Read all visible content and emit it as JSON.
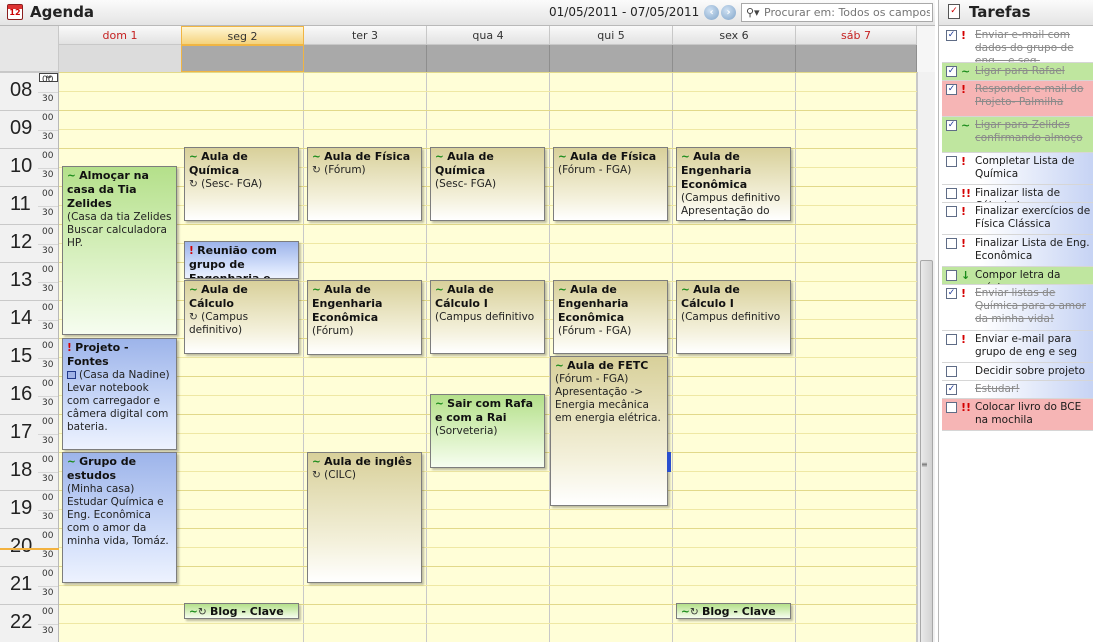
{
  "agenda": {
    "title": "Agenda",
    "icon": "calendar-icon",
    "date_range": "01/05/2011 - 07/05/2011",
    "search_placeholder": "Procurar em: Todos os campos",
    "days": [
      "dom 1",
      "seg 2",
      "ter 3",
      "qua 4",
      "qui 5",
      "sex 6",
      "sáb 7"
    ],
    "hours": [
      "08",
      "09",
      "10",
      "11",
      "12",
      "13",
      "14",
      "15",
      "16",
      "17",
      "18",
      "19",
      "20",
      "21",
      "22"
    ],
    "minute_labels": [
      "00",
      "30"
    ],
    "colors": {
      "weekday_bg": "#fffed7",
      "weekend_header": "#c52020",
      "today_border": "#f0b543"
    }
  },
  "events": {
    "dom_almocar": {
      "title": "Almoçar na casa da Tia Zelides",
      "lines": [
        "(Casa da tia Zelides",
        "Buscar calculadora HP."
      ]
    },
    "dom_projeto": {
      "title": "Projeto - Fontes",
      "lines": [
        "(Casa da Nadine)",
        "Levar notebook com carregador e câmera digital com bateria."
      ]
    },
    "dom_grupo": {
      "title": "Grupo de estudos",
      "lines": [
        "(Minha casa)",
        "Estudar Química e Eng. Econômica com o amor da minha vida, Tomáz."
      ]
    },
    "seg_quimica": {
      "title": "Aula de Química",
      "lines": [
        "(Sesc- FGA)"
      ]
    },
    "seg_reuniao": {
      "title": "Reunião com grupo de Engenharia e",
      "lines": []
    },
    "seg_calculo": {
      "title": "Aula de Cálculo",
      "lines": [
        "(Campus definitivo)"
      ]
    },
    "seg_blog": {
      "title": "Blog - Clave",
      "lines": []
    },
    "ter_fisica": {
      "title": "Aula de Física",
      "lines": [
        "(Fórum)"
      ]
    },
    "ter_engecon": {
      "title": "Aula de Engenharia Econômica",
      "lines": [
        "(Fórum)"
      ]
    },
    "ter_ingles": {
      "title": "Aula de inglês",
      "lines": [
        "(CILC)"
      ]
    },
    "qua_quimica": {
      "title": "Aula de Química",
      "lines": [
        "(Sesc- FGA)"
      ]
    },
    "qua_calculo": {
      "title": "Aula de Cálculo I",
      "lines": [
        "(Campus definitivo"
      ]
    },
    "qua_sair": {
      "title": "Sair com Rafa e com a Rai",
      "lines": [
        "(Sorveteria)"
      ]
    },
    "qui_fisica": {
      "title": "Aula de Física",
      "lines": [
        "(Fórum - FGA)"
      ]
    },
    "qui_engecon": {
      "title": "Aula de Engenharia Econômica",
      "lines": [
        "(Fórum - FGA)"
      ]
    },
    "qui_fetc": {
      "title": "Aula de FETC",
      "lines": [
        "(Fórum - FGA)",
        "Apresentação -> Energia mecânica em energia elétrica."
      ]
    },
    "sex_engecon": {
      "title": "Aula de Engenharia Econômica",
      "lines": [
        "(Campus definitivo",
        "Apresentação do seminário. Tema:"
      ]
    },
    "sex_calculo": {
      "title": "Aula de Cálculo I",
      "lines": [
        "(Campus definitivo"
      ]
    },
    "sex_blog": {
      "title": "Blog - Clave",
      "lines": []
    }
  },
  "tasks": {
    "title": "Tarefas",
    "items": [
      {
        "label": "Enviar e-mail com dados do grupo de eng... e seg.",
        "checked": true,
        "priority": "!",
        "color": "plain",
        "done": true
      },
      {
        "label": "Ligar para Rafael",
        "checked": true,
        "priority": "~",
        "color": "green",
        "done": true
      },
      {
        "label": "Responder e-mail do Projeto- Palmilha",
        "checked": true,
        "priority": "!",
        "color": "red",
        "done": true
      },
      {
        "label": "Ligar para Zelides confirmando almoço",
        "checked": true,
        "priority": "~",
        "color": "green",
        "done": true
      },
      {
        "label": "Completar Lista de Química",
        "checked": false,
        "priority": "!",
        "color": "blue",
        "done": false
      },
      {
        "label": "Finalizar lista de Cálculo I",
        "checked": false,
        "priority": "!!",
        "color": "blue",
        "done": false
      },
      {
        "label": "Finalizar exercícios de Física Clássica",
        "checked": false,
        "priority": "!",
        "color": "blue",
        "done": false
      },
      {
        "label": "Finalizar Lista de Eng. Econômica",
        "checked": false,
        "priority": "!",
        "color": "blue",
        "done": false
      },
      {
        "label": "Compor letra da música",
        "checked": false,
        "priority": "↓",
        "color": "green",
        "done": false
      },
      {
        "label": "Enviar listas de Química para o amor da minha vida!",
        "checked": true,
        "priority": "!",
        "color": "blue",
        "done": true
      },
      {
        "label": "Enviar e-mail para grupo de eng e seg",
        "checked": false,
        "priority": "!",
        "color": "blue",
        "done": false
      },
      {
        "label": "Decidir sobre projeto",
        "checked": false,
        "priority": "",
        "color": "blue",
        "done": false
      },
      {
        "label": "Estudar!",
        "checked": true,
        "priority": "",
        "color": "blue",
        "done": true
      },
      {
        "label": "Colocar livro do BCE na mochila",
        "checked": false,
        "priority": "!!",
        "color": "red",
        "done": false
      }
    ]
  }
}
